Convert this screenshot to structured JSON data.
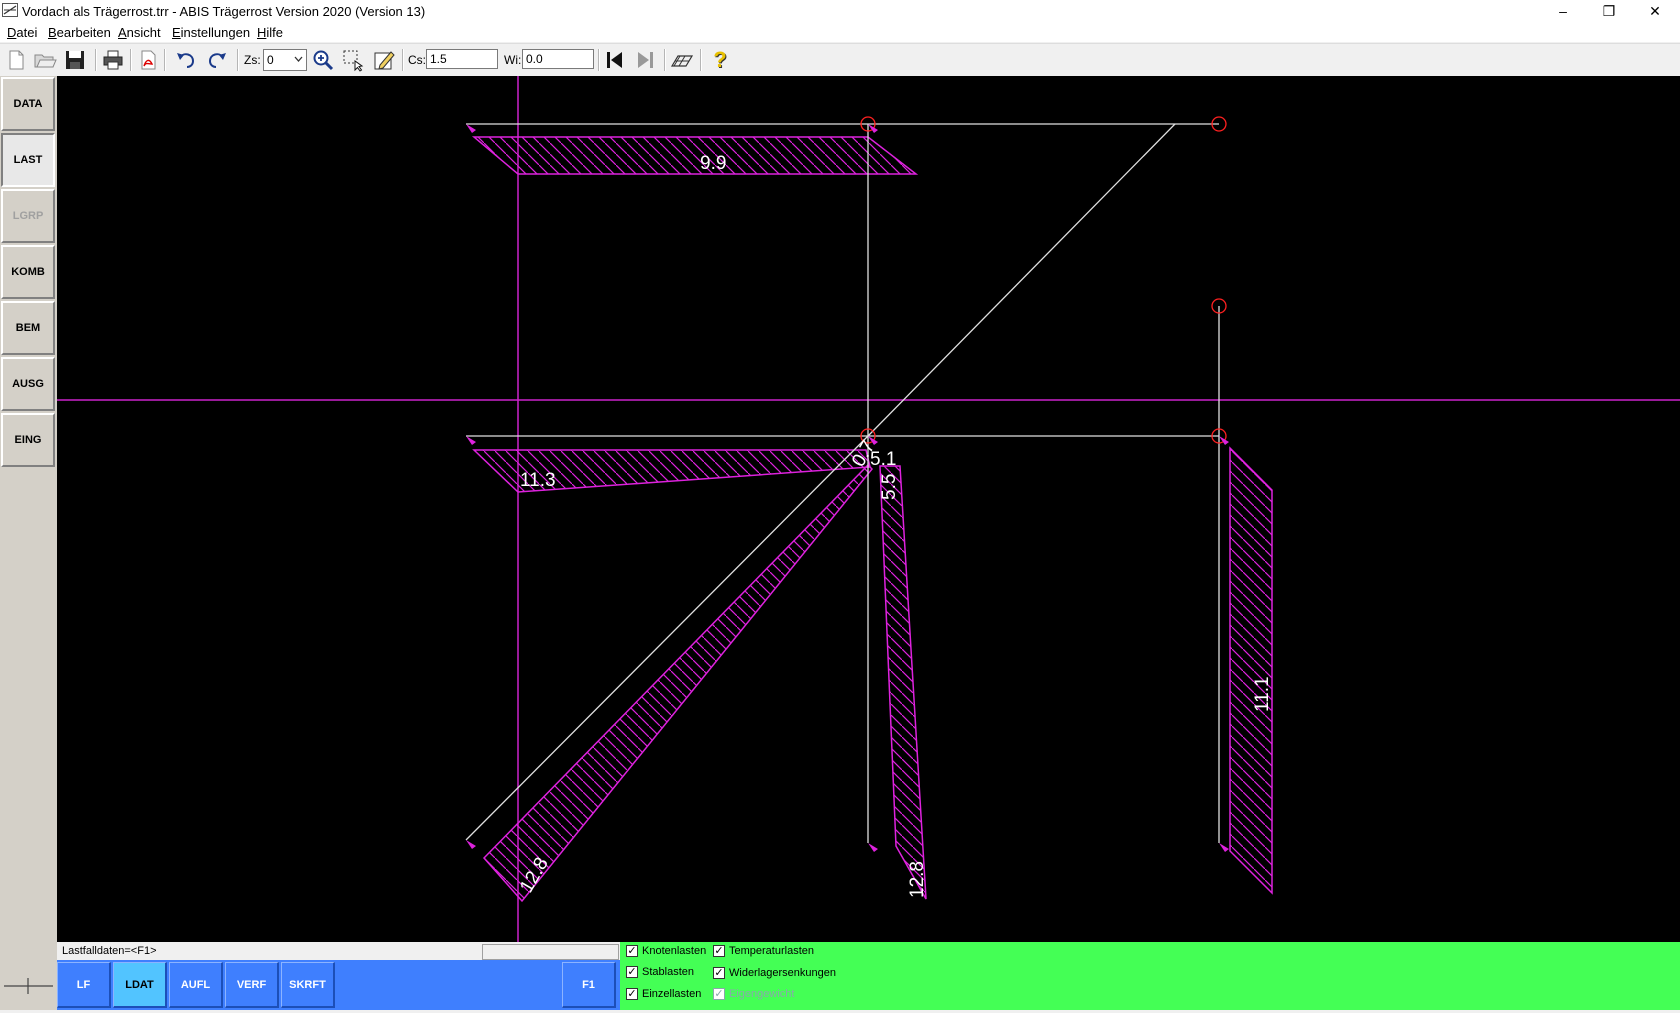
{
  "window": {
    "title": "Vordach als Trägerrost.trr - ABIS Trägerrost Version 2020 (Version 13)",
    "minimize": "–",
    "restore": "❐",
    "close": "✕"
  },
  "menu": [
    {
      "label": "Datei",
      "u": "D",
      "rest": "atei"
    },
    {
      "label": "Bearbeiten",
      "u": "B",
      "rest": "earbeiten"
    },
    {
      "label": "Ansicht",
      "u": "A",
      "rest": "nsicht"
    },
    {
      "label": "Einstellungen",
      "u": "E",
      "rest": "instellungen"
    },
    {
      "label": "Hilfe",
      "u": "H",
      "rest": "ilfe"
    }
  ],
  "toolbar": {
    "zs_label": "Zs:",
    "zs_value": "0",
    "cs_label": "Cs:",
    "cs_value": "1.5",
    "wi_label": "Wi:",
    "wi_value": "0.0",
    "help_glyph": "?"
  },
  "sidebar": [
    {
      "label": "DATA",
      "state": "normal"
    },
    {
      "label": "LAST",
      "state": "active"
    },
    {
      "label": "LGRP",
      "state": "disabled"
    },
    {
      "label": "KOMB",
      "state": "normal"
    },
    {
      "label": "BEM",
      "state": "normal"
    },
    {
      "label": "AUSG",
      "state": "normal"
    },
    {
      "label": "EING",
      "state": "normal"
    }
  ],
  "canvas": {
    "labels": {
      "top": "9.9",
      "left": "11.3",
      "center_a": "0.7",
      "center_b": "5.1",
      "center_c": "5.5",
      "diag": "12.8",
      "mid_bottom": "12.8",
      "right": "11.1"
    },
    "colors": {
      "axis": "#cc22cc",
      "beam": "#e0e0e0",
      "load": "#dd22dd",
      "support": "#ff2020"
    }
  },
  "status": {
    "text": "Lastfalldaten=<F1>"
  },
  "bottom": {
    "buttons": [
      {
        "label": "LF",
        "active": false
      },
      {
        "label": "LDAT",
        "active": true
      },
      {
        "label": "AUFL",
        "active": false
      },
      {
        "label": "VERF",
        "active": false
      },
      {
        "label": "SKRFT",
        "active": false
      }
    ],
    "f1": "F1"
  },
  "filters": [
    {
      "label": "Knotenlasten",
      "checked": true,
      "enabled": true
    },
    {
      "label": "Stablasten",
      "checked": true,
      "enabled": true
    },
    {
      "label": "Einzellasten",
      "checked": true,
      "enabled": true
    },
    {
      "label": "Temperaturlasten",
      "checked": true,
      "enabled": true
    },
    {
      "label": "Widerlagersenkungen",
      "checked": true,
      "enabled": true
    },
    {
      "label": "Eigengewicht",
      "checked": true,
      "enabled": false
    }
  ]
}
